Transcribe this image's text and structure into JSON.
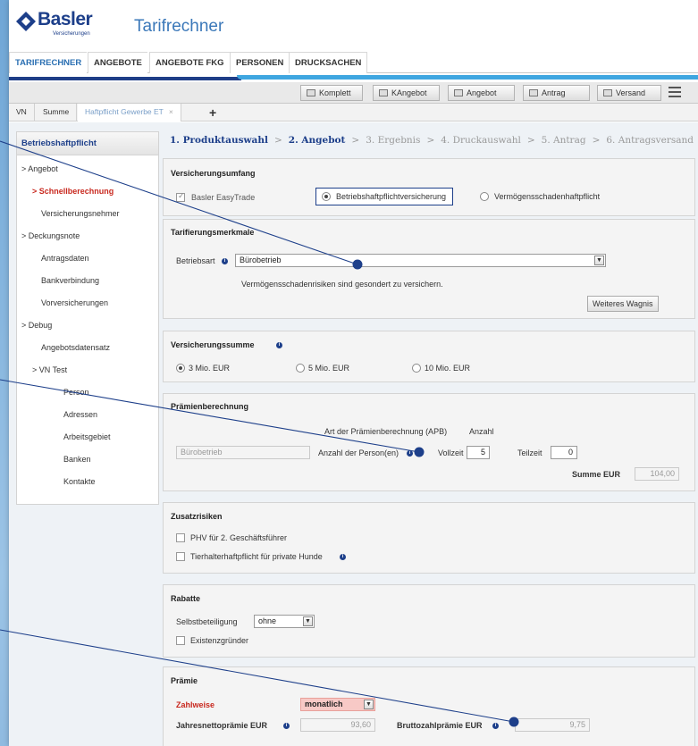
{
  "header": {
    "logo_name": "Basler",
    "logo_sub": "Versicherungen",
    "title": "Tarifrechner"
  },
  "mainnav": [
    "TARIFRECHNER",
    "ANGEBOTE",
    "ANGEBOTE FKG",
    "PERSONEN",
    "DRUCKSACHEN"
  ],
  "toolbar": {
    "komplett": "Komplett",
    "kangebot": "KAngebot",
    "angebot": "Angebot",
    "antrag": "Antrag",
    "versand": "Versand"
  },
  "subtabs": {
    "vn": "VN",
    "summe": "Summe",
    "haftpflicht": "Haftpflicht Gewerbe ET",
    "close": "×",
    "add": "+"
  },
  "sidebar": {
    "title": "Betriebshaftpflicht",
    "items": [
      "Angebot",
      "Schnellberechnung",
      "Versicherungsnehmer",
      "Deckungsnote",
      "Antragsdaten",
      "Bankverbindung",
      "Vorversicherungen",
      "Debug",
      "Angebotsdatensatz",
      "VN Test",
      "Person",
      "Adressen",
      "Arbeitsgebiet",
      "Banken",
      "Kontakte"
    ]
  },
  "steps": {
    "s1": "1. Produktauswahl",
    "s2": "2. Angebot",
    "s3": "3. Ergebnis",
    "s4": "4. Druckauswahl",
    "s5": "5. Antrag",
    "s6": "6. Antragsversand",
    "sep": ">"
  },
  "versicherungsumfang": {
    "title": "Versicherungsumfang",
    "easytrade": "Basler EasyTrade",
    "opt1": "Betriebshaftpflichtversicherung",
    "opt2": "Vermögensschadenhaftpflicht"
  },
  "tarifierung": {
    "title": "Tarifierungsmerkmale",
    "betriebsart_label": "Betriebsart",
    "betriebsart_value": "Bürobetrieb",
    "hint": "Vermögensschadenrisiken sind gesondert zu versichern.",
    "weiteres": "Weiteres Wagnis"
  },
  "summe": {
    "title": "Versicherungssumme",
    "o1": "3 Mio. EUR",
    "o2": "5 Mio. EUR",
    "o3": "10 Mio. EUR"
  },
  "praemienberechnung": {
    "title": "Prämienberechnung",
    "art_label": "Art der Prämienberechnung (APB)",
    "anzahl_label": "Anzahl",
    "betrieb": "Bürobetrieb",
    "personen_label": "Anzahl der Person(en)",
    "vollzeit_label": "Vollzeit",
    "vollzeit_value": "5",
    "teilzeit_label": "Teilzeit",
    "teilzeit_value": "0",
    "summe_label": "Summe EUR",
    "summe_value": "104,00"
  },
  "zusatz": {
    "title": "Zusatzrisiken",
    "phv": "PHV für 2. Geschäftsführer",
    "tier": "Tierhalterhaftpflicht für private Hunde"
  },
  "rabatte": {
    "title": "Rabatte",
    "sb_label": "Selbstbeteiligung",
    "sb_value": "ohne",
    "existenz": "Existenzgründer"
  },
  "praemie": {
    "title": "Prämie",
    "zahlweise_label": "Zahlweise",
    "zahlweise_value": "monatlich",
    "jahres_label": "Jahresnettoprämie EUR",
    "jahres_value": "93,60",
    "brutto_label": "Bruttozahlprämie EUR",
    "brutto_value": "9,75"
  },
  "info_glyph": "i",
  "colors": {
    "brand": "#1d3f8a",
    "accent": "#3fa6e0",
    "active_red": "#c8281e"
  }
}
